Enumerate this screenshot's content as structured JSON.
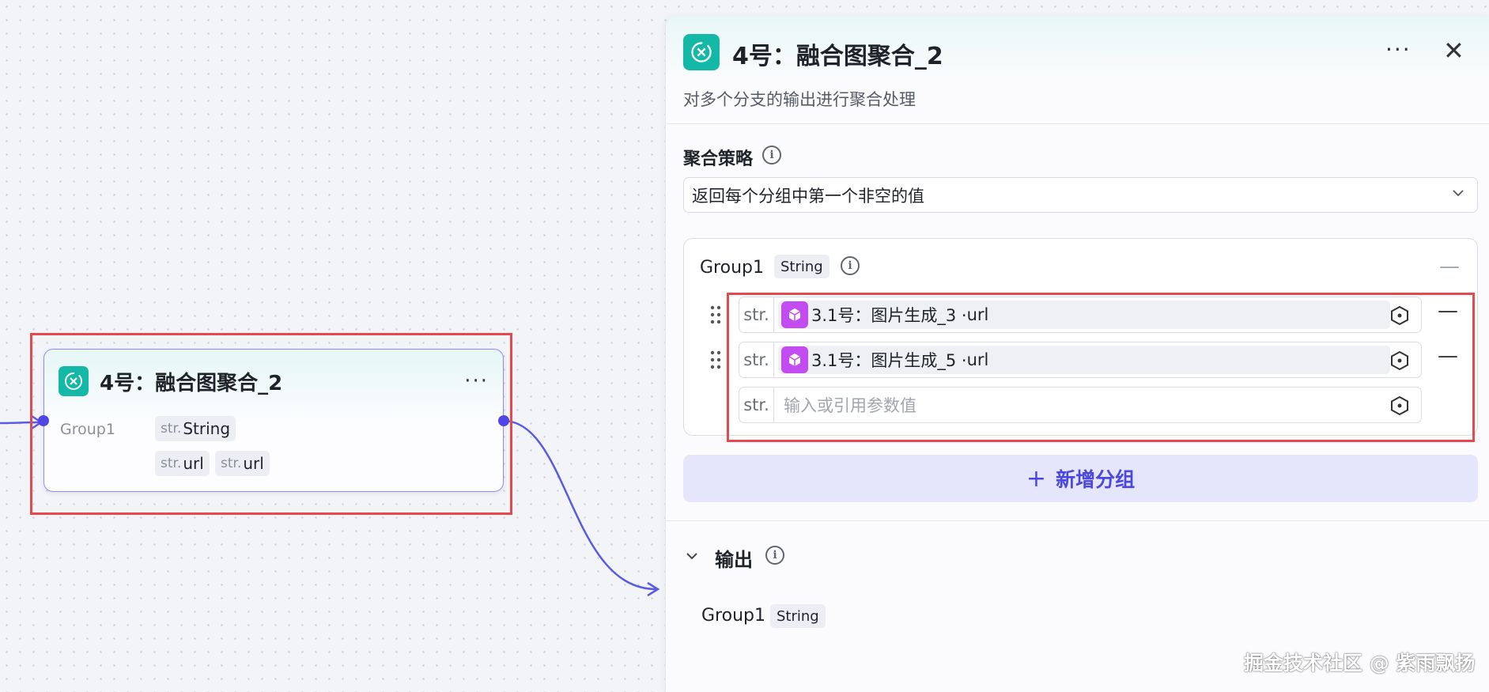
{
  "canvas": {
    "node": {
      "title": "4号：融合图聚合_2",
      "more": "···",
      "group_label": "Group1",
      "chips": [
        {
          "prefix": "str.",
          "value": "String"
        },
        {
          "prefix": "str.",
          "value": "url"
        },
        {
          "prefix": "str.",
          "value": "url"
        }
      ]
    }
  },
  "panel": {
    "title": "4号：融合图聚合_2",
    "description": "对多个分支的输出进行聚合处理",
    "more": "···",
    "close": "✕",
    "strategy": {
      "label": "聚合策略",
      "info": "i",
      "selected": "返回每个分组中第一个非空的值"
    },
    "group": {
      "name": "Group1",
      "type": "String",
      "info": "i",
      "collapse": "—",
      "rows": [
        {
          "prefix": "str.",
          "ref_label": "3.1号：图片生成_3 · ",
          "ref_field": "url",
          "remove": "—"
        },
        {
          "prefix": "str.",
          "ref_label": "3.1号：图片生成_5 · ",
          "ref_field": "url",
          "remove": "—"
        }
      ],
      "input": {
        "prefix": "str.",
        "placeholder": "输入或引用参数值"
      }
    },
    "add_group": {
      "plus": "+",
      "label": "新增分组"
    },
    "output": {
      "label": "输出",
      "info": "i",
      "group_name": "Group1",
      "group_type": "String"
    }
  },
  "watermark": "掘金技术社区 @ 紫雨飘扬",
  "colors": {
    "accent": "#5046e5",
    "highlight": "#e5484d",
    "node_icon": "#14b8a6",
    "ref_icon": "#c34cf0"
  }
}
